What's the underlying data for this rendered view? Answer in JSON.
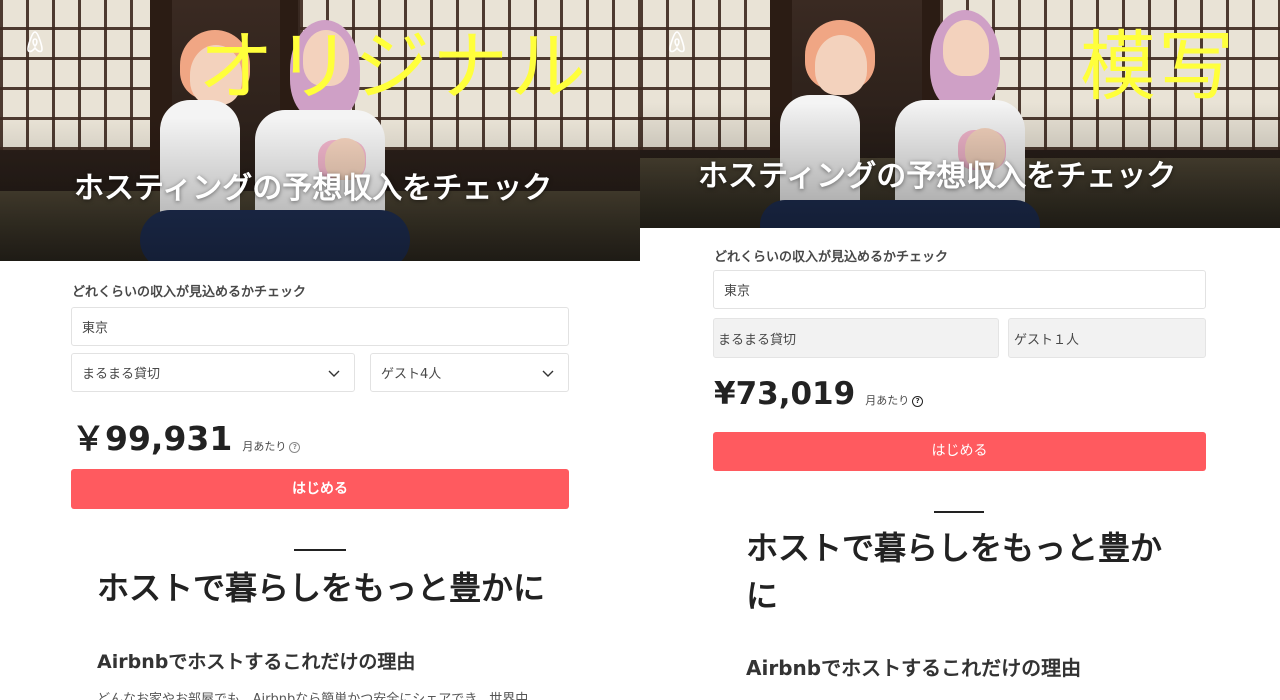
{
  "labels": {
    "original": "オリジナル",
    "copy": "模写"
  },
  "brand_color": "#ff5a5f",
  "overlay_color": "#ffff3b",
  "left": {
    "hero_title": "ホスティングの予想収入をチェック",
    "form_label": "どれくらいの収入が見込めるかチェック",
    "location": "東京",
    "property_type": "まるまる貸切",
    "guests": "ゲスト4人",
    "price": "￥99,931",
    "per_month": "月あたり",
    "help": "?",
    "cta": "はじめる",
    "section_title": "ホストで暮らしをもっと豊かに",
    "sub_title": "Airbnbでホストするこれだけの理由",
    "body": "どんなお家やお部屋でも、Airbnbなら簡単かつ安全にシェアでき、世界中"
  },
  "right": {
    "hero_title": "ホスティングの予想収入をチェック",
    "form_label": "どれくらいの収入が見込めるかチェック",
    "location": "東京",
    "property_type": "まるまる貸切",
    "guests": "ゲスト１人",
    "price": "¥73,019",
    "per_month": "月あたり",
    "help": "?",
    "cta": "はじめる",
    "section_title": "ホストで暮らしをもっと豊かに",
    "sub_title": "Airbnbでホストするこれだけの理由"
  }
}
